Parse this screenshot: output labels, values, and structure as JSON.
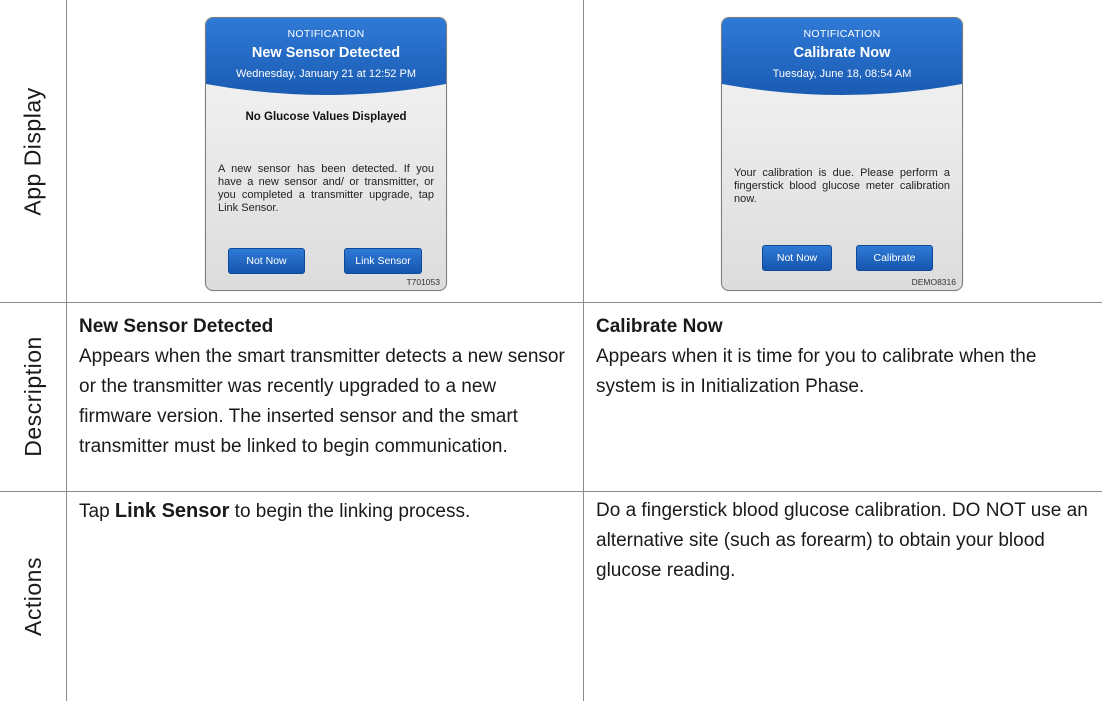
{
  "row_labels": {
    "app_display": "App Display",
    "description": "Description",
    "actions": "Actions"
  },
  "left_card": {
    "kicker": "NOTIFICATION",
    "title": "New Sensor Detected",
    "date": "Wednesday, January 21 at 12:52 PM",
    "subtitle": "No Glucose Values Displayed",
    "body": "A new sensor has been detected. If you have a new sensor and/ or transmitter, or you completed a transmitter upgrade, tap Link Sensor.",
    "button_left": "Not Now",
    "button_right": "Link Sensor",
    "code": "T701053"
  },
  "right_card": {
    "kicker": "NOTIFICATION",
    "title": "Calibrate Now",
    "date": "Tuesday, June 18, 08:54 AM",
    "body": "Your calibration is due. Please perform a fingerstick blood glucose meter calibration now.",
    "button_left": "Not Now",
    "button_right": "Calibrate",
    "code": "DEMO8316"
  },
  "description": {
    "left_title": "New Sensor Detected",
    "left_text": "Appears when the smart transmitter detects a new sensor or the transmitter was recently upgraded to a new firmware version. The inserted sensor and the smart transmitter must be linked to begin communication.",
    "right_title": "Calibrate Now",
    "right_text": "Appears when it is time for you to calibrate when the system is in Initialization Phase."
  },
  "actions": {
    "left_prefix": "Tap ",
    "left_bold": "Link Sensor",
    "left_suffix": " to begin the linking process.",
    "right_text": "Do a fingerstick blood glucose calibration. DO NOT use an alternative site (such as forearm) to obtain your blood glucose reading."
  },
  "colors": {
    "header_blue": "#2468c2",
    "button_blue": "#1e64c0",
    "rule_gray": "#8a8a8a"
  }
}
